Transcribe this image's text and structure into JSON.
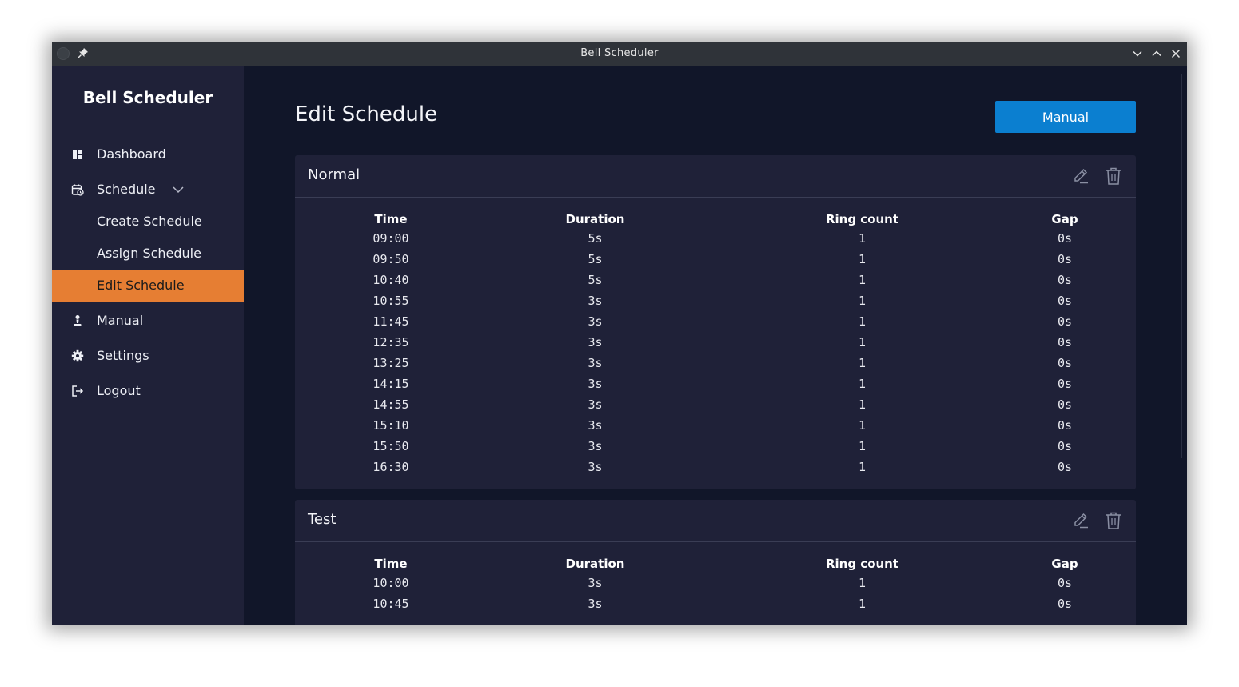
{
  "window": {
    "title": "Bell Scheduler"
  },
  "sidebar": {
    "brand": "Bell Scheduler",
    "items": [
      {
        "label": "Dashboard",
        "icon": "dashboard-icon"
      },
      {
        "label": "Schedule",
        "icon": "calendar-clock-icon",
        "expanded": true
      },
      {
        "label": "Create Schedule"
      },
      {
        "label": "Assign Schedule"
      },
      {
        "label": "Edit Schedule",
        "active": true
      },
      {
        "label": "Manual",
        "icon": "bell-person-icon"
      },
      {
        "label": "Settings",
        "icon": "gear-icon"
      },
      {
        "label": "Logout",
        "icon": "logout-icon"
      }
    ]
  },
  "main": {
    "title": "Edit Schedule",
    "manual_button": "Manual"
  },
  "columns": [
    "Time",
    "Duration",
    "Ring count",
    "Gap"
  ],
  "schedules": [
    {
      "name": "Normal",
      "rows": [
        [
          "09:00",
          "5s",
          "1",
          "0s"
        ],
        [
          "09:50",
          "5s",
          "1",
          "0s"
        ],
        [
          "10:40",
          "5s",
          "1",
          "0s"
        ],
        [
          "10:55",
          "3s",
          "1",
          "0s"
        ],
        [
          "11:45",
          "3s",
          "1",
          "0s"
        ],
        [
          "12:35",
          "3s",
          "1",
          "0s"
        ],
        [
          "13:25",
          "3s",
          "1",
          "0s"
        ],
        [
          "14:15",
          "3s",
          "1",
          "0s"
        ],
        [
          "14:55",
          "3s",
          "1",
          "0s"
        ],
        [
          "15:10",
          "3s",
          "1",
          "0s"
        ],
        [
          "15:50",
          "3s",
          "1",
          "0s"
        ],
        [
          "16:30",
          "3s",
          "1",
          "0s"
        ]
      ]
    },
    {
      "name": "Test",
      "rows": [
        [
          "10:00",
          "3s",
          "1",
          "0s"
        ],
        [
          "10:45",
          "3s",
          "1",
          "0s"
        ]
      ]
    }
  ],
  "colors": {
    "sidebar_bg": "#1f2138",
    "main_bg": "#111629",
    "active_item": "#e67e33",
    "primary_button": "#0b7fd0"
  }
}
